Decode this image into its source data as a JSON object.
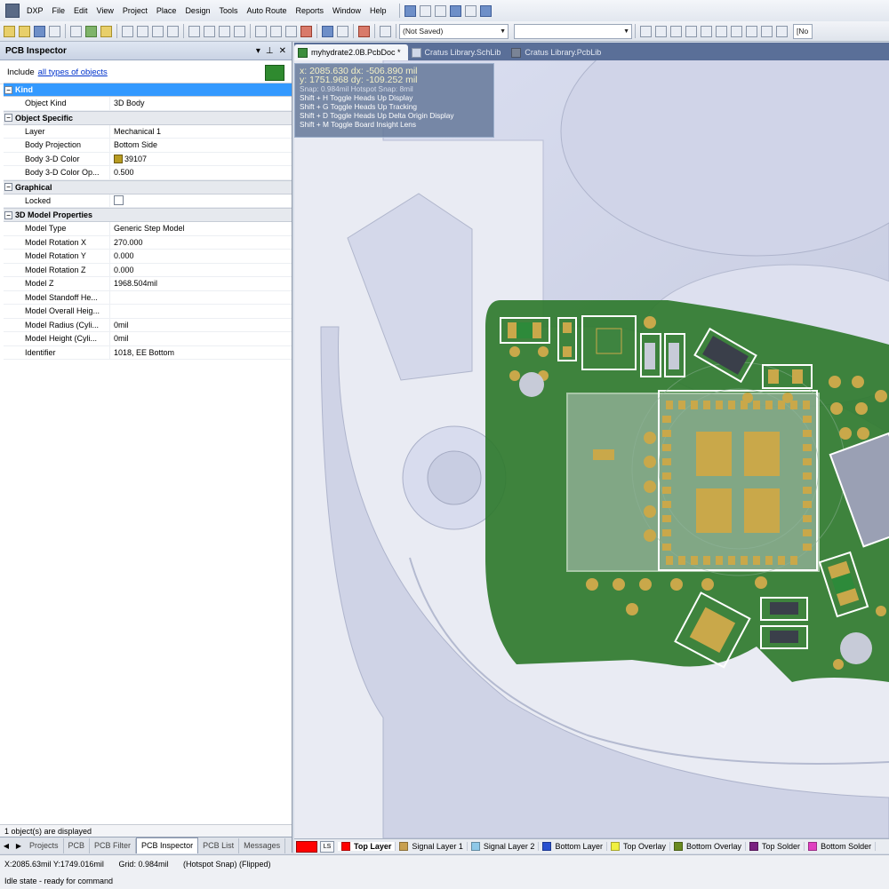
{
  "app": {
    "name": "DXP"
  },
  "menu": [
    "File",
    "Edit",
    "View",
    "Project",
    "Place",
    "Design",
    "Tools",
    "Auto Route",
    "Reports",
    "Window",
    "Help"
  ],
  "toolbar": {
    "saved_combo": "(Not Saved)",
    "right_combo": "[No"
  },
  "panel": {
    "title": "PCB Inspector",
    "include_prefix": "Include",
    "include_link": "all types of objects",
    "categories": [
      {
        "name": "Kind",
        "selected": true,
        "rows": [
          {
            "k": "Object Kind",
            "v": "3D Body"
          }
        ]
      },
      {
        "name": "Object Specific",
        "rows": [
          {
            "k": "Layer",
            "v": "Mechanical 1"
          },
          {
            "k": "Body Projection",
            "v": "Bottom Side"
          },
          {
            "k": "Body 3-D Color",
            "v": "39107",
            "swatch": "#b89c22"
          },
          {
            "k": "Body 3-D Color Op...",
            "v": "0.500"
          }
        ]
      },
      {
        "name": "Graphical",
        "rows": [
          {
            "k": "Locked",
            "v": "",
            "checkbox": true
          }
        ]
      },
      {
        "name": "3D Model Properties",
        "rows": [
          {
            "k": "Model Type",
            "v": "Generic Step Model"
          },
          {
            "k": "Model Rotation X",
            "v": "270.000"
          },
          {
            "k": "Model Rotation Y",
            "v": "0.000"
          },
          {
            "k": "Model Rotation Z",
            "v": "0.000"
          },
          {
            "k": "Model Z",
            "v": "1968.504mil"
          },
          {
            "k": "Model Standoff He...",
            "v": ""
          },
          {
            "k": "Model Overall Heig...",
            "v": ""
          },
          {
            "k": "Model Radius (Cyli...",
            "v": "0mil"
          },
          {
            "k": "Model Height (Cyli...",
            "v": "0mil"
          },
          {
            "k": "Identifier",
            "v": "1018, EE Bottom"
          }
        ]
      }
    ],
    "status": "1 object(s) are displayed",
    "tabs": [
      "Projects",
      "PCB",
      "PCB Filter",
      "PCB Inspector",
      "PCB List",
      "Messages"
    ],
    "active_tab": "PCB Inspector"
  },
  "doc_tabs": [
    {
      "label": "myhydrate2.0B.PcbDoc *",
      "active": true,
      "icon": "pcbdoc-icon"
    },
    {
      "label": "Cratus Library.SchLib",
      "active": false,
      "icon": "schlib-icon"
    },
    {
      "label": "Cratus Library.PcbLib",
      "active": false,
      "icon": "pcblib-icon"
    }
  ],
  "hud": {
    "line1": "x:  2085.630   dx:  -506.890 mil",
    "line2": "y:  1751.968   dy:  -109.252 mil",
    "snap": "Snap: 0.984mil Hotspot Snap: 8mil",
    "shortcuts": [
      "Shift + H   Toggle Heads Up Display",
      "Shift + G   Toggle Heads Up Tracking",
      "Shift + D   Toggle Heads Up Delta Origin Display",
      "Shift + M   Toggle Board Insight Lens"
    ]
  },
  "layer_tabs": {
    "ls": "LS",
    "current_color": "#ff0000",
    "layers": [
      {
        "name": "Top Layer",
        "color": "#ff0000",
        "active": true
      },
      {
        "name": "Signal Layer 1",
        "color": "#c8a050"
      },
      {
        "name": "Signal Layer 2",
        "color": "#8ec8e8"
      },
      {
        "name": "Bottom Layer",
        "color": "#2850d0"
      },
      {
        "name": "Top Overlay",
        "color": "#f0f040"
      },
      {
        "name": "Bottom Overlay",
        "color": "#6a8a20"
      },
      {
        "name": "Top Solder",
        "color": "#7a2080"
      },
      {
        "name": "Bottom Solder",
        "color": "#e040c0"
      }
    ]
  },
  "status": {
    "coords": "X:2085.63mil Y:1749.016mil",
    "grid": "Grid: 0.984mil",
    "snap": "(Hotspot Snap) (Flipped)",
    "state": "Idle state - ready for command"
  },
  "colors": {
    "board_green": "#2f7a2e",
    "pad_gold": "#c9a84a",
    "body_lavender": "#d6daee",
    "selection_blue": "#3399ff"
  }
}
